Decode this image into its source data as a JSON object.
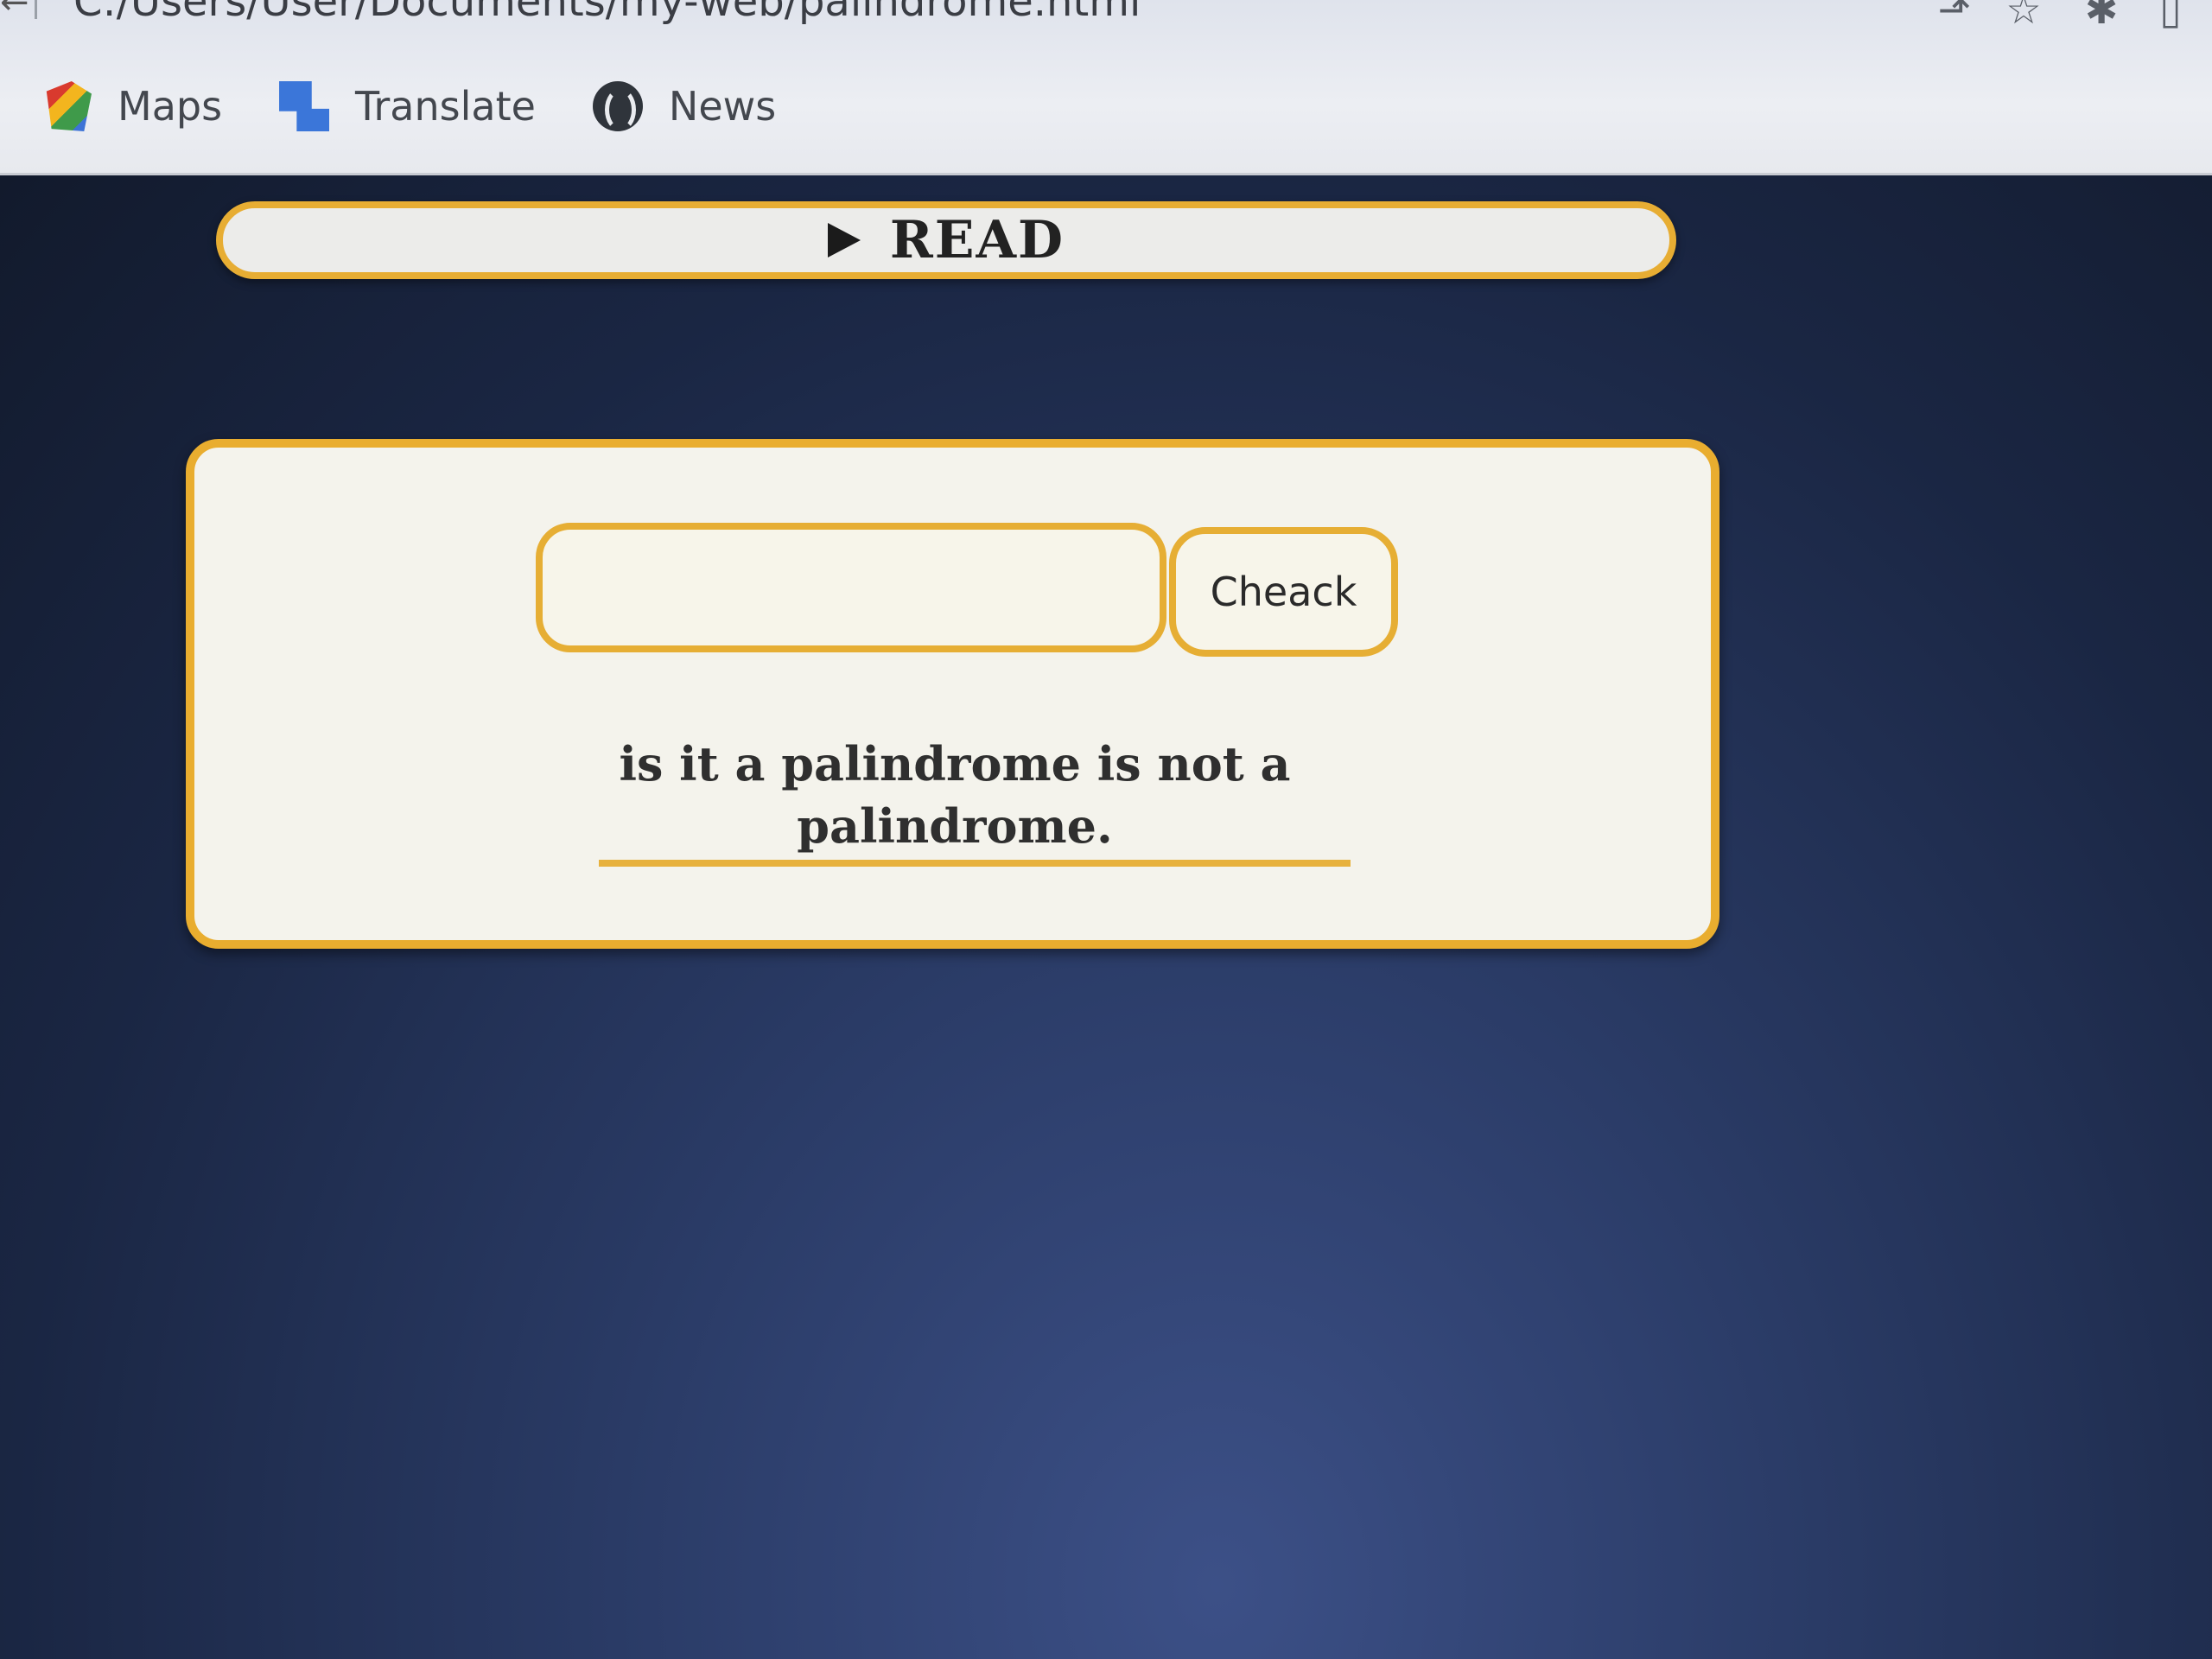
{
  "browser": {
    "address_bar": {
      "url": "C:/Users/User/Documents/my-web/palindrome.html"
    },
    "toolbar_icons": [
      "share-icon",
      "star-icon",
      "extensions-icon",
      "sidebar-icon"
    ],
    "bookmarks": [
      {
        "label": "Maps",
        "icon": "maps-icon"
      },
      {
        "label": "Translate",
        "icon": "translate-icon"
      },
      {
        "label": "News",
        "icon": "globe-icon"
      }
    ]
  },
  "page": {
    "read_button": {
      "label": "READ",
      "icon": "play-icon"
    },
    "checker": {
      "input": {
        "value": "",
        "placeholder": ""
      },
      "check_button_label": "Cheack",
      "result_text": "is it a palindrome is not a palindrome."
    },
    "colors": {
      "accent": "#e9ad2f",
      "card_bg": "#f4f3ec",
      "page_bg": "#1f2c47"
    }
  }
}
